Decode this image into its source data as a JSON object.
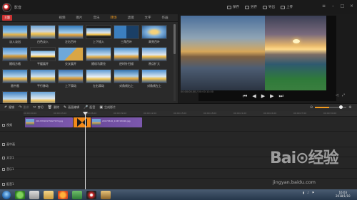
{
  "app": {
    "title": "影音",
    "lib_badge": "主题"
  },
  "toolbar_top": [
    {
      "label": "保存",
      "icon": "save-icon"
    },
    {
      "label": "另存",
      "icon": "save-as-icon"
    },
    {
      "label": "导出",
      "icon": "export-icon"
    },
    {
      "label": "上传",
      "icon": "upload-icon"
    }
  ],
  "tabs": [
    "视频",
    "图片",
    "音乐",
    "转场",
    "滤镜",
    "文字",
    "作画"
  ],
  "active_tab_index": 3,
  "transitions": [
    "淡入淡出",
    "白色淡入",
    "左右百叶",
    "上下插入",
    "三角百叶",
    "高亮百叶",
    "随机方格",
    "平缓展开",
    "交叉展开",
    "随机马赛克",
    "逆时针扫描",
    "原点扩大",
    "画中画",
    "平行移动",
    "上下滑动",
    "左右滑动",
    "对角线右上",
    "对角线左上",
    "圆形划出",
    "菱形划出"
  ],
  "preview": {
    "time_current": "00:00:00.00",
    "time_total": "00:00:10.00"
  },
  "edit_toolbar": [
    {
      "label": "撤销",
      "icon": "undo-icon"
    },
    {
      "label": "重做",
      "icon": "redo-icon"
    },
    {
      "label": "剪切",
      "icon": "cut-icon"
    },
    {
      "label": "删除",
      "icon": "delete-icon"
    },
    {
      "label": "画面编辑",
      "icon": "edit-icon"
    },
    {
      "label": "配音",
      "icon": "mic-icon"
    },
    {
      "label": "生成影片",
      "icon": "film-icon"
    }
  ],
  "ruler_ticks": [
    "00:00:00.00",
    "00:00:03.00",
    "00:00:06.00",
    "00:00:09.00",
    "00:00:12.00",
    "00:00:15.00",
    "00:00:18.00",
    "00:00:21.00",
    "00:00:24.00",
    "00:00:27.00",
    "00:00:30.00"
  ],
  "tracks": [
    "视频",
    "画中画",
    "文字1",
    "音乐1",
    "配音1"
  ],
  "clips": [
    {
      "name": "20170518175927170.jpg"
    },
    {
      "name": "20170520_134715040.jpg"
    }
  ],
  "zoom_level": 0.45,
  "clock": {
    "time": "16:03",
    "date": "2018/1/10"
  },
  "watermark": {
    "brand": "Bai⊙经验",
    "url": "jingyan.baidu.com"
  },
  "colors": {
    "accent": "#f29a1f",
    "clip": "#7c58ad",
    "transition": "#f28a1a"
  }
}
